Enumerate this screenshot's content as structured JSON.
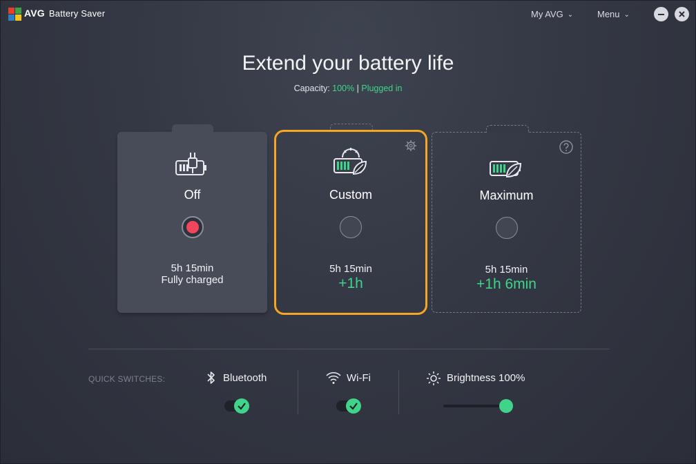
{
  "app": {
    "brand": "AVG",
    "name": "Battery Saver",
    "logo_icon": "avg-logo-icon"
  },
  "titlebar": {
    "my_avg": "My AVG",
    "menu": "Menu",
    "minimize_icon": "minimize-icon",
    "close_icon": "close-icon"
  },
  "header": {
    "title": "Extend your battery life",
    "capacity_label": "Capacity:",
    "capacity_value": "100%",
    "separator": "|",
    "power_status": "Plugged in"
  },
  "modes": [
    {
      "title": "Off",
      "selected": true,
      "time": "5h 15min",
      "sub": "Fully charged",
      "icon": "battery-plug-icon"
    },
    {
      "title": "Custom",
      "selected": false,
      "highlighted": true,
      "time": "5h 15min",
      "gain": "+1h",
      "icon": "battery-gear-leaf-icon",
      "corner_icon": "gear-icon"
    },
    {
      "title": "Maximum",
      "selected": false,
      "time": "5h 15min",
      "gain": "+1h 6min",
      "icon": "battery-leaf-icon",
      "corner_icon": "help-icon"
    }
  ],
  "quick_switches": {
    "label": "QUICK SWITCHES:",
    "bluetooth": {
      "label": "Bluetooth",
      "on": true,
      "icon": "bluetooth-icon"
    },
    "wifi": {
      "label": "Wi-Fi",
      "on": true,
      "icon": "wifi-icon"
    },
    "brightness": {
      "label": "Brightness 100%",
      "value": 100,
      "icon": "sun-icon"
    }
  },
  "colors": {
    "accent_green": "#3fd48a",
    "highlight_orange": "#f5a623",
    "selected_red": "#f0465c",
    "background": "#343844"
  }
}
